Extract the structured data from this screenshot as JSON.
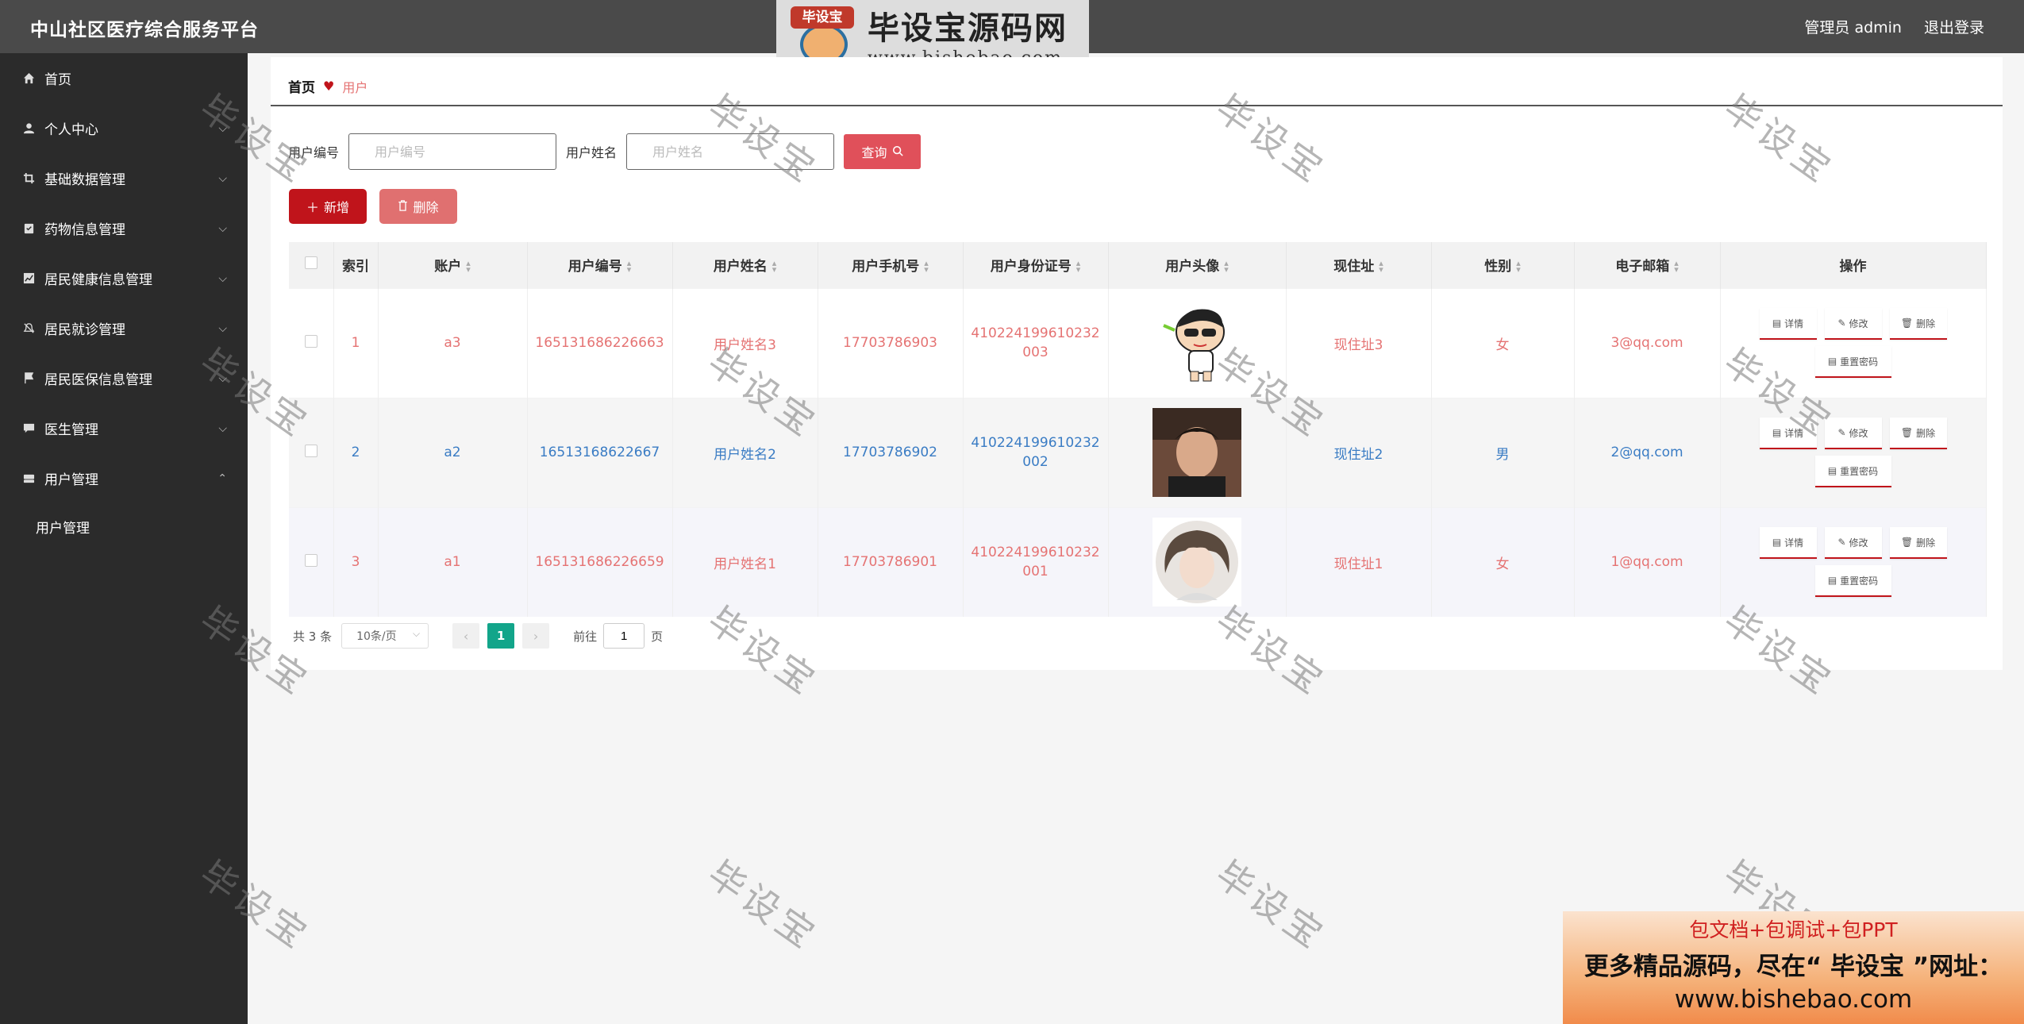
{
  "header": {
    "app_title": "中山社区医疗综合服务平台",
    "admin_label": "管理员 admin",
    "logout_label": "退出登录"
  },
  "logo": {
    "cap_text": "毕设宝",
    "title": "毕设宝源码网",
    "url": "www.bishebao.com"
  },
  "sidebar": {
    "items": [
      {
        "label": "首页",
        "icon": "home-icon",
        "chevron": ""
      },
      {
        "label": "个人中心",
        "icon": "person-icon",
        "chevron": "⌵"
      },
      {
        "label": "基础数据管理",
        "icon": "crop-icon",
        "chevron": "⌵"
      },
      {
        "label": "药物信息管理",
        "icon": "clipboard-icon",
        "chevron": "⌵"
      },
      {
        "label": "居民健康信息管理",
        "icon": "chart-icon",
        "chevron": "⌵"
      },
      {
        "label": "居民就诊管理",
        "icon": "bell-icon",
        "chevron": "⌵"
      },
      {
        "label": "居民医保信息管理",
        "icon": "flag-icon",
        "chevron": "⌵"
      },
      {
        "label": "医生管理",
        "icon": "chat-icon",
        "chevron": "⌵"
      },
      {
        "label": "用户管理",
        "icon": "drive-icon",
        "chevron": "⌃"
      }
    ],
    "sub_item": "用户管理"
  },
  "breadcrumb": {
    "home": "首页",
    "current": "用户"
  },
  "search": {
    "user_no_label": "用户编号",
    "user_no_placeholder": "用户编号",
    "user_name_label": "用户姓名",
    "user_name_placeholder": "用户姓名",
    "query_label": "查询"
  },
  "actions": {
    "add_label": "新增",
    "delete_label": "删除"
  },
  "table": {
    "headers": [
      "索引",
      "账户",
      "用户编号",
      "用户姓名",
      "用户手机号",
      "用户身份证号",
      "用户头像",
      "现住址",
      "性别",
      "电子邮箱",
      "操作"
    ],
    "rows": [
      {
        "index": "1",
        "account": "a3",
        "user_no": "165131686226663",
        "name": "用户姓名3",
        "phone": "17703786903",
        "id_card": "410224199610232003",
        "address": "现住址3",
        "gender": "女",
        "email": "3@qq.com"
      },
      {
        "index": "2",
        "account": "a2",
        "user_no": "16513168622667",
        "name": "用户姓名2",
        "phone": "17703786902",
        "id_card": "410224199610232002",
        "address": "现住址2",
        "gender": "男",
        "email": "2@qq.com"
      },
      {
        "index": "3",
        "account": "a1",
        "user_no": "165131686226659",
        "name": "用户姓名1",
        "phone": "17703786901",
        "id_card": "410224199610232001",
        "address": "现住址1",
        "gender": "女",
        "email": "1@qq.com"
      }
    ],
    "op_labels": {
      "detail": "详情",
      "edit": "修改",
      "delete": "删除",
      "reset": "重置密码"
    }
  },
  "pagination": {
    "total_text": "共 3 条",
    "page_size": "10条/页",
    "current_page": "1",
    "goto_label": "前往",
    "goto_value": "1",
    "page_suffix": "页"
  },
  "watermark_text": "毕设宝",
  "promo": {
    "line1": "包文档+包调试+包PPT",
    "line2": "更多精品源码，尽在“ 毕设宝 ”网址：",
    "line3": "www.bishebao.com"
  },
  "colors": {
    "header_bg": "#4a4a4a",
    "sidebar_bg": "#2b2b2b",
    "primary_red": "#c0141b",
    "page_active": "#12a58a",
    "row_red_text": "#e57373",
    "row_blue_text": "#3a7cc4"
  }
}
